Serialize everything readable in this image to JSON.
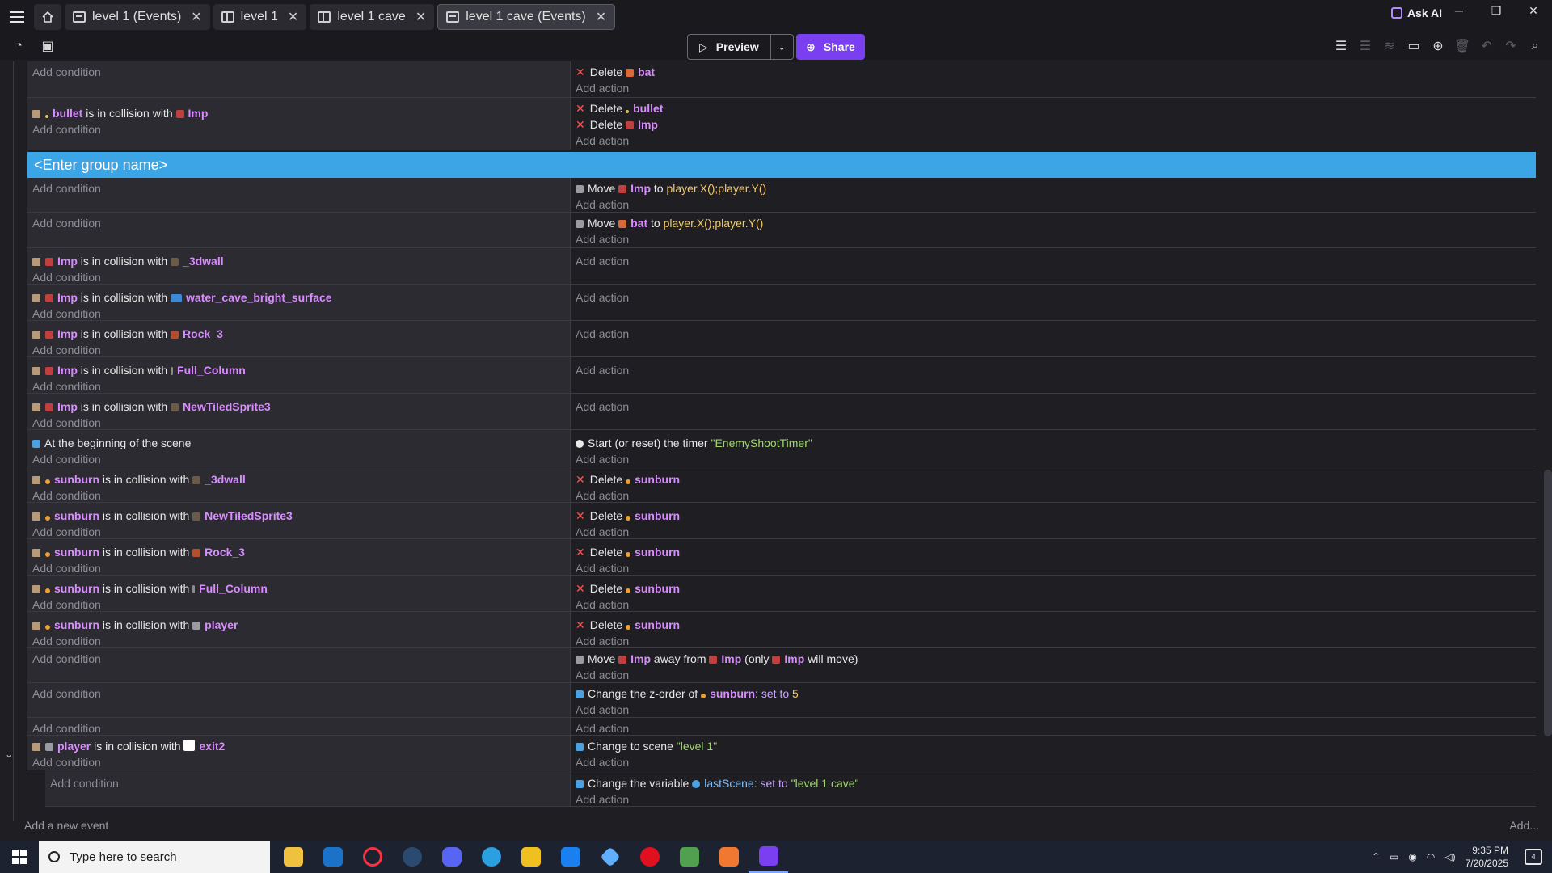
{
  "tabs": [
    {
      "label": "level 1 (Events)",
      "type": "events"
    },
    {
      "label": "level 1",
      "type": "scene"
    },
    {
      "label": "level 1 cave",
      "type": "scene"
    },
    {
      "label": "level 1 cave (Events)",
      "type": "events"
    }
  ],
  "header": {
    "ask_ai": "Ask AI",
    "preview": "Preview",
    "share": "Share"
  },
  "group_name": "<Enter group name>",
  "add_condition": "Add condition",
  "add_action": "Add action",
  "add_new_event": "Add a new event",
  "add_more": "Add...",
  "words": {
    "is_in_collision_with": "is in collision with",
    "delete": "Delete",
    "move": "Move",
    "to": "to",
    "away_from": "away from",
    "only": "(only",
    "will_move": "will move)",
    "change_z": "Change the z-order of",
    "set_to": "set to",
    "change_scene": "Change to scene",
    "change_var": "Change the variable",
    "start_timer": "Start (or reset) the timer",
    "beginning": "At the beginning of the scene"
  },
  "objects": {
    "bat": "bat",
    "bullet": "bullet",
    "imp": "Imp",
    "wall": "_3dwall",
    "water": "water_cave_bright_surface",
    "rock": "Rock_3",
    "column": "Full_Column",
    "tiled": "NewTiledSprite3",
    "sunburn": "sunburn",
    "player": "player",
    "exit": "exit2",
    "lastscene": "lastScene"
  },
  "values": {
    "player_pos": "player.X();player.Y()",
    "timer_name": "\"EnemyShootTimer\"",
    "z_value": "5",
    "scene_level1": "\"level 1\"",
    "scene_cave": "\"level 1 cave\""
  },
  "taskbar": {
    "search_placeholder": "Type here to search",
    "time": "9:35 PM",
    "date": "7/20/2025",
    "notifications": "4"
  },
  "colors": {
    "accent": "#7b3ff2",
    "group": "#3ba5e6",
    "object": "#d98cff",
    "string": "#9fd66d",
    "expression": "#f2c96b",
    "delete": "#ff5050"
  }
}
